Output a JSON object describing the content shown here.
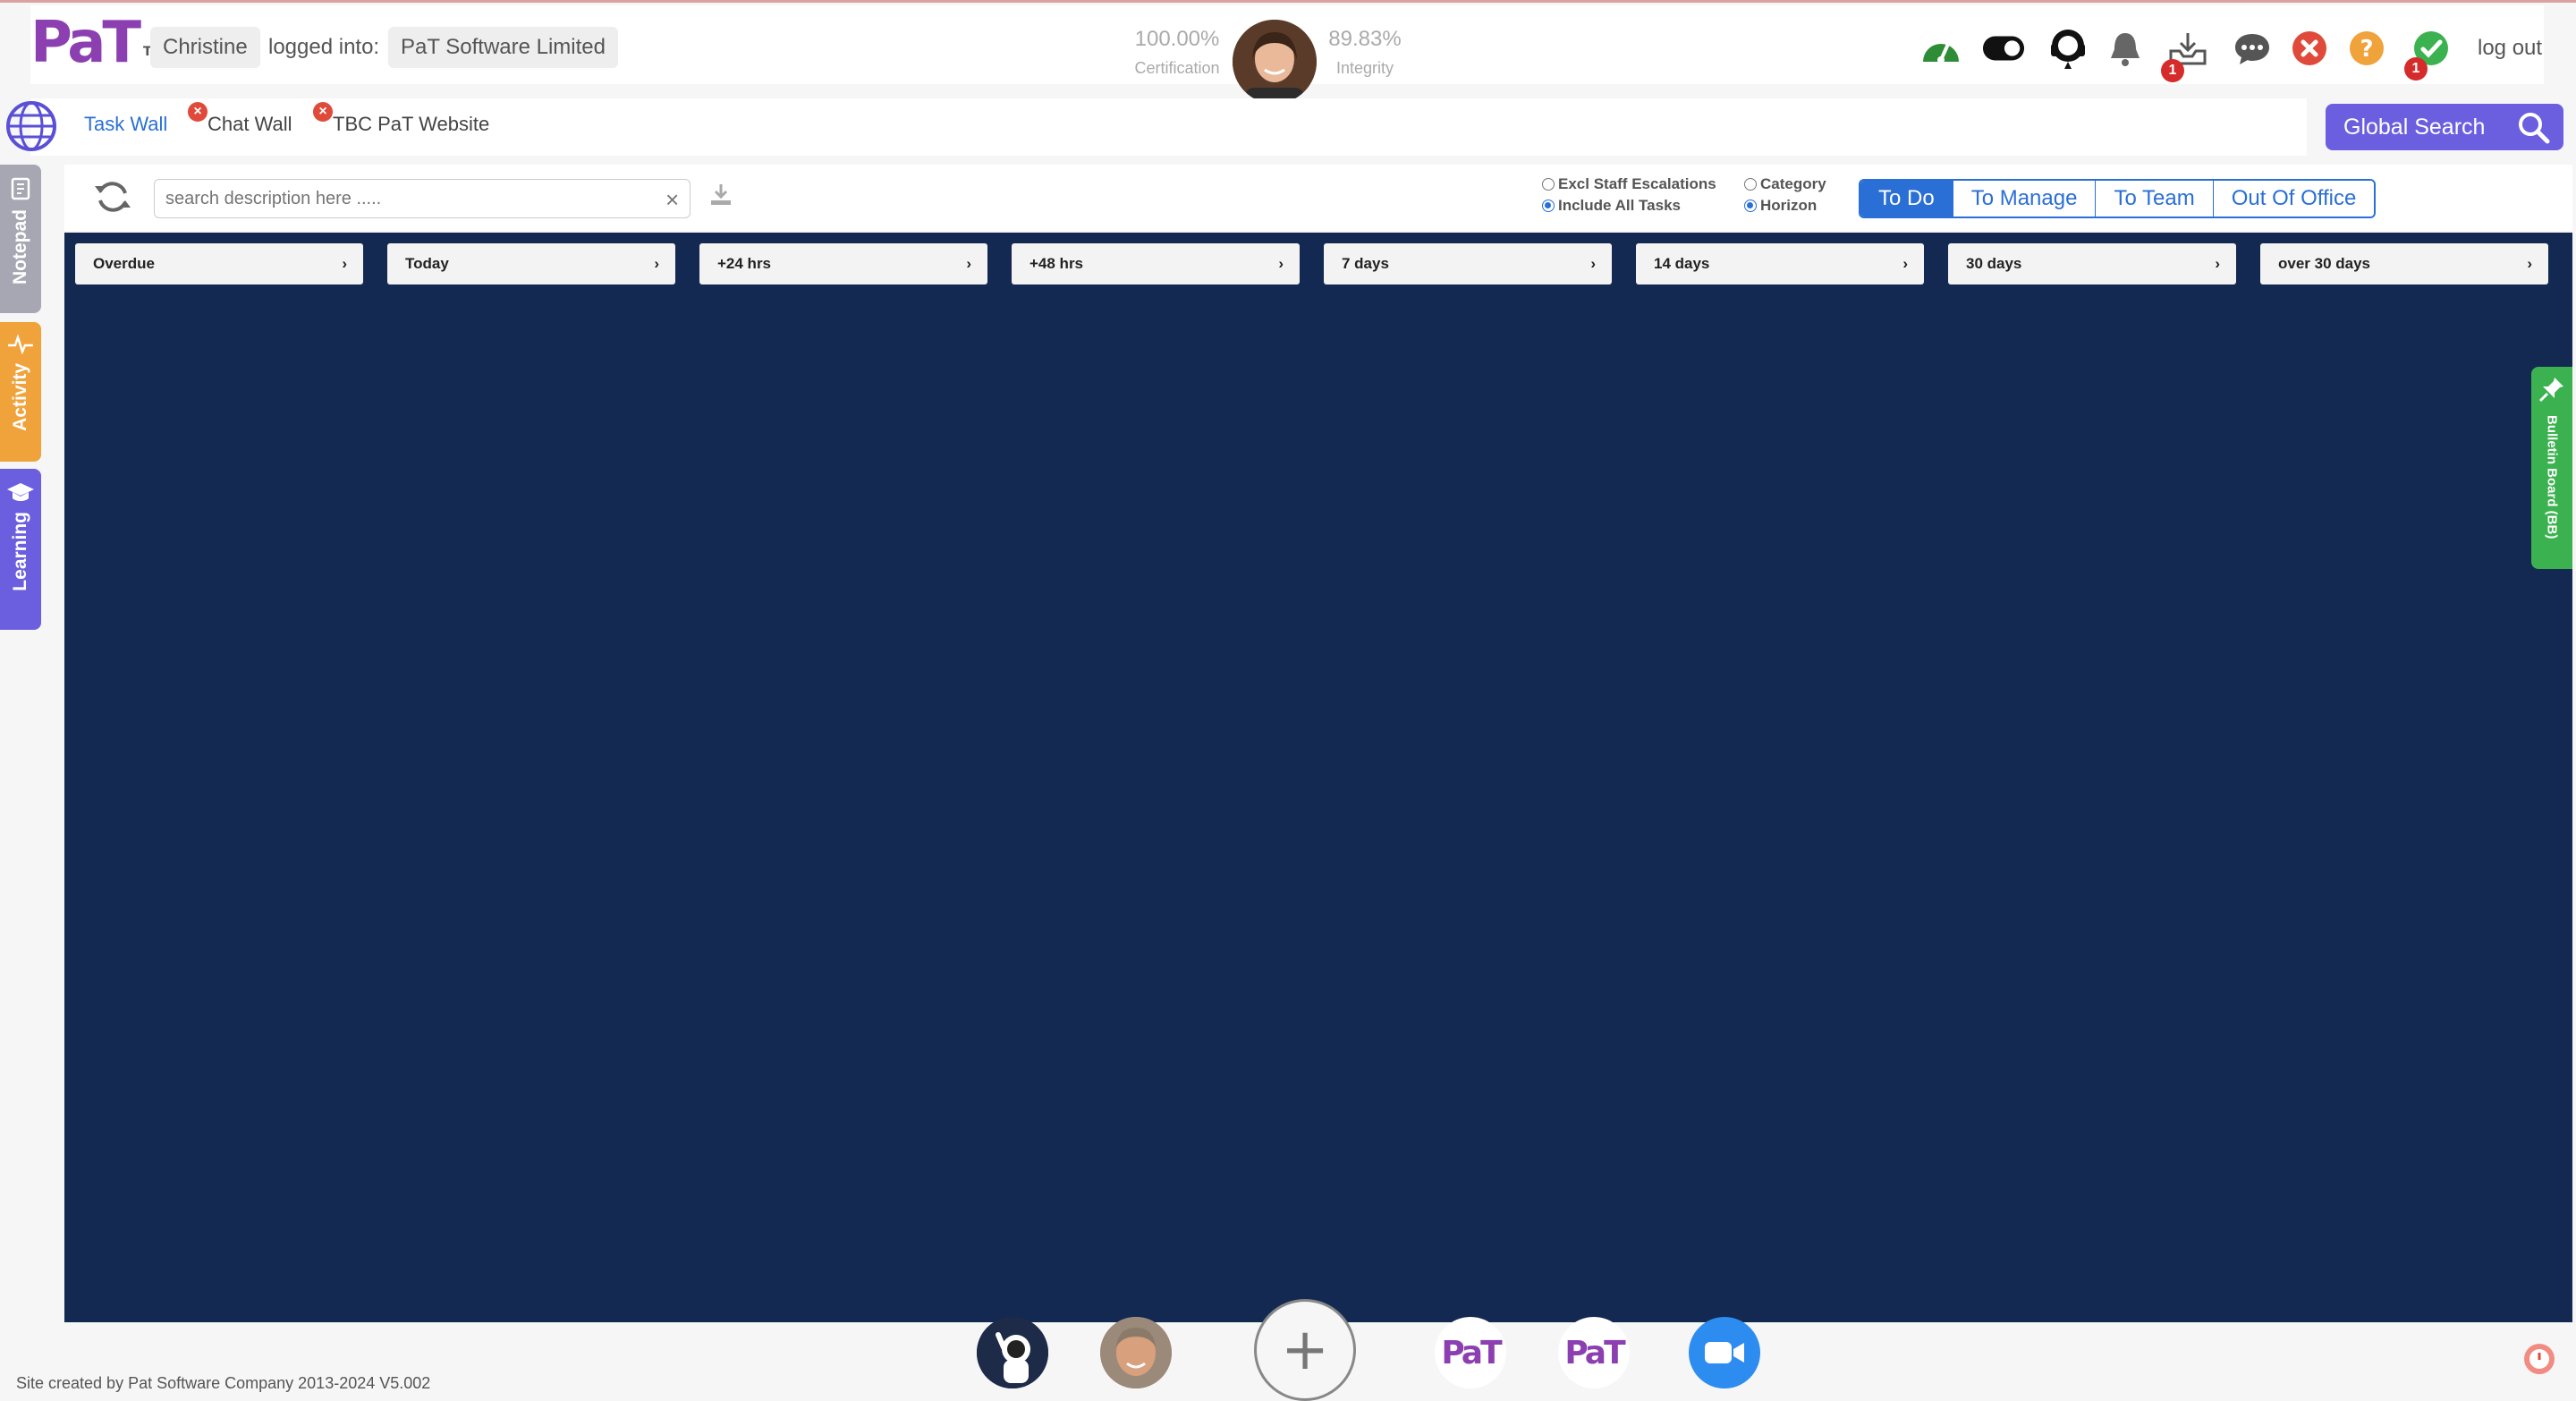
{
  "header": {
    "logo_text": "PaT",
    "logo_tm": "TM",
    "user_name": "Christine",
    "logged_into_label": "logged into:",
    "company": "PaT Software Limited",
    "certification_value": "100.00%",
    "certification_label": "Certification",
    "integrity_value": "89.83%",
    "integrity_label": "Integrity",
    "inbox_badge": "1",
    "tasks_badge": "1",
    "logout_label": "log out"
  },
  "tabs": [
    {
      "label": "Task Wall",
      "active": true
    },
    {
      "label": "Chat Wall",
      "close": "×"
    },
    {
      "label": "TBC PaT Website",
      "close": "×"
    }
  ],
  "global_search_label": "Global Search",
  "side_tabs": {
    "notepad": "Notepad",
    "activity": "Activity",
    "learning": "Learning"
  },
  "toolbar": {
    "search_placeholder": "search description here .....",
    "clear_symbol": "×",
    "filter_excl": "Excl Staff Escalations",
    "filter_include": "Include All Tasks",
    "sort_category": "Category",
    "sort_horizon": "Horizon",
    "views": [
      "To Do",
      "To Manage",
      "To Team",
      "Out Of Office"
    ],
    "active_view": "To Do"
  },
  "columns": [
    "Overdue",
    "Today",
    "+24 hrs",
    "+48 hrs",
    "7 days",
    "14 days",
    "30 days",
    "over 30 days"
  ],
  "column_arrow": "›",
  "bulletin_label": "Bulletin Board (BB)",
  "dock": {
    "plus": "+",
    "pat_logo": "PaT"
  },
  "footer": "Site created by Pat Software Company 2013-2024 V5.002",
  "colors": {
    "board": "#132952",
    "accent": "#2a6fd6",
    "global_search": "#6b5fe0",
    "notepad_tab": "#a7a7b3",
    "activity_tab": "#f0a23b",
    "learning_tab": "#6b5fe0",
    "bulletin": "#3bb24f"
  }
}
